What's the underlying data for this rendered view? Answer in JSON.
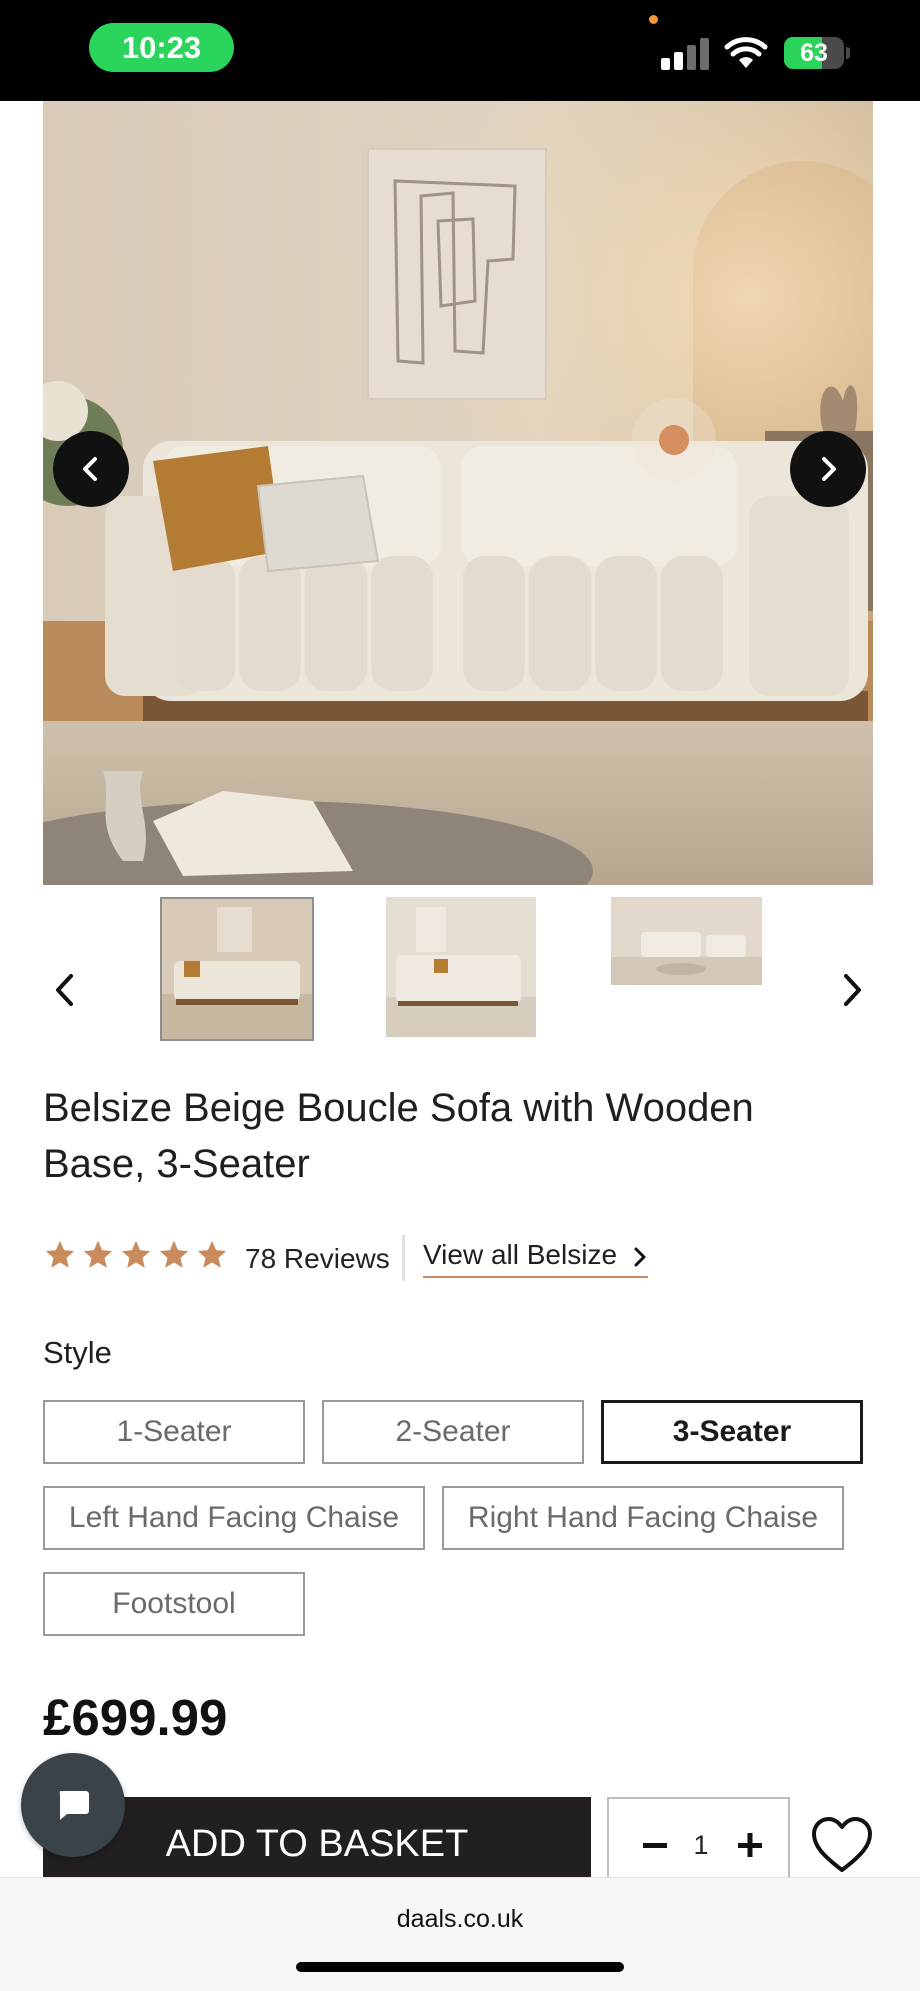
{
  "status_bar": {
    "time": "10:23",
    "battery_percent": "63",
    "battery_level": 0.63,
    "icons": [
      "cellular-signal-icon",
      "wifi-icon",
      "battery-charging-icon"
    ]
  },
  "gallery": {
    "hero_alt_subject": "cream boucle sofa in living room",
    "prev_icon": "chevron-left-icon",
    "next_icon": "chevron-right-icon",
    "thumbnail_count": 3,
    "active_thumbnail": 1
  },
  "product": {
    "title": "Belsize Beige Boucle Sofa with Wooden Base, 3-Seater",
    "rating_stars": 5,
    "reviews_label": "78 Reviews",
    "view_all_label": "View all Belsize",
    "price": "£699.99"
  },
  "style": {
    "label": "Style",
    "options": [
      {
        "label": "1-Seater",
        "selected": false
      },
      {
        "label": "2-Seater",
        "selected": false
      },
      {
        "label": "3-Seater",
        "selected": true
      },
      {
        "label": "Left Hand Facing Chaise",
        "selected": false
      },
      {
        "label": "Right Hand Facing Chaise",
        "selected": false
      },
      {
        "label": "Footstool",
        "selected": false
      }
    ]
  },
  "purchase": {
    "add_to_basket_label": "ADD TO BASKET",
    "quantity": "1"
  },
  "browser": {
    "url": "daals.co.uk"
  },
  "colors": {
    "accent": "#c98a5c",
    "star": "#c98a5c",
    "button_dark": "#231f20",
    "status_green": "#2bd45a"
  }
}
